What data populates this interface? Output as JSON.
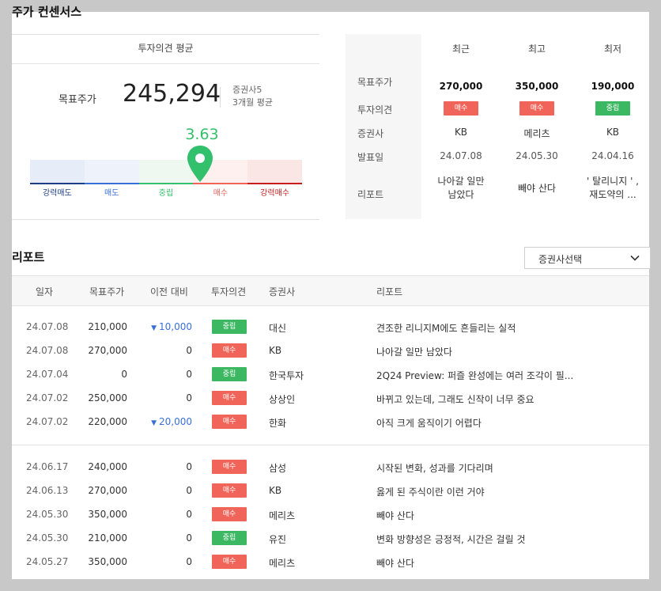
{
  "section_title": "주가 컨센서스",
  "consensus": {
    "header": "투자의견 평균",
    "target_label": "목표주가",
    "target_price": "245,294",
    "meta_firms": "증권사5",
    "meta_period": "3개월 평균",
    "score": "3.63",
    "score_value": 3.63,
    "scale_labels": [
      "강력매도",
      "매도",
      "중립",
      "매수",
      "강력매수"
    ],
    "colors": {
      "strong_sell_bg": "#e6edf9",
      "sell_bg": "#eef3fb",
      "neutral_bg": "#eef8f0",
      "buy_bg": "#fdf0ef",
      "strong_sell": "#1e3f86",
      "sell": "#3a6fd8",
      "neutral": "#33c06d",
      "buy": "#f0645a",
      "strong_buy": "#c41e1e"
    }
  },
  "consensus_table": {
    "col_headers": [
      "최근",
      "최고",
      "최저"
    ],
    "row_labels": [
      "목표주가",
      "투자의견",
      "증권사",
      "발표일",
      "리포트"
    ],
    "columns": [
      {
        "target": "270,000",
        "opinion": "매수",
        "opinion_type": "buy",
        "firm": "KB",
        "date": "24.07.08",
        "report_line1": "나아갈 일만",
        "report_line2": "남았다"
      },
      {
        "target": "350,000",
        "opinion": "매수",
        "opinion_type": "buy",
        "firm": "메리츠",
        "date": "24.05.30",
        "report_line1": "빼야 산다",
        "report_line2": ""
      },
      {
        "target": "190,000",
        "opinion": "중립",
        "opinion_type": "neutral",
        "firm": "KB",
        "date": "24.04.16",
        "report_line1": "' 탈리니지 ' ,",
        "report_line2": "재도약의 ..."
      }
    ]
  },
  "reports": {
    "title": "리포트",
    "dropdown_label": "증권사선택",
    "headers": [
      "일자",
      "목표주가",
      "이전 대비",
      "투자의견",
      "증권사",
      "리포트"
    ],
    "rows": [
      {
        "date": "24.07.08",
        "target": "210,000",
        "change": "10,000",
        "change_dir": "down",
        "opinion": "중립",
        "opinion_type": "neutral",
        "firm": "대신",
        "report": "견조한 리니지M에도 흔들리는 실적"
      },
      {
        "date": "24.07.08",
        "target": "270,000",
        "change": "0",
        "change_dir": "none",
        "opinion": "매수",
        "opinion_type": "buy",
        "firm": "KB",
        "report": "나아갈 일만 남았다"
      },
      {
        "date": "24.07.04",
        "target": "0",
        "change": "0",
        "change_dir": "none",
        "opinion": "중립",
        "opinion_type": "neutral",
        "firm": "한국투자",
        "report": "2Q24 Preview: 퍼즐 완성에는 여러 조각이 필..."
      },
      {
        "date": "24.07.02",
        "target": "250,000",
        "change": "0",
        "change_dir": "none",
        "opinion": "매수",
        "opinion_type": "buy",
        "firm": "상상인",
        "report": "바뀌고 있는데, 그래도 신작이 너무 중요"
      },
      {
        "date": "24.07.02",
        "target": "220,000",
        "change": "20,000",
        "change_dir": "down",
        "opinion": "매수",
        "opinion_type": "buy",
        "firm": "한화",
        "report": "아직 크게 움직이기 어렵다"
      },
      {
        "date": "24.06.17",
        "target": "240,000",
        "change": "0",
        "change_dir": "none",
        "opinion": "매수",
        "opinion_type": "buy",
        "firm": "삼성",
        "report": "시작된 변화, 성과를 기다리며"
      },
      {
        "date": "24.06.13",
        "target": "270,000",
        "change": "0",
        "change_dir": "none",
        "opinion": "매수",
        "opinion_type": "buy",
        "firm": "KB",
        "report": "옳게 된 주식이란 이런 거야"
      },
      {
        "date": "24.05.30",
        "target": "350,000",
        "change": "0",
        "change_dir": "none",
        "opinion": "매수",
        "opinion_type": "buy",
        "firm": "메리츠",
        "report": "빼야 산다"
      },
      {
        "date": "24.05.30",
        "target": "210,000",
        "change": "0",
        "change_dir": "none",
        "opinion": "중립",
        "opinion_type": "neutral",
        "firm": "유진",
        "report": "변화 방향성은 긍정적, 시간은 걸릴 것"
      },
      {
        "date": "24.05.27",
        "target": "350,000",
        "change": "0",
        "change_dir": "none",
        "opinion": "매수",
        "opinion_type": "buy",
        "firm": "메리츠",
        "report": "빼야 산다"
      }
    ]
  }
}
